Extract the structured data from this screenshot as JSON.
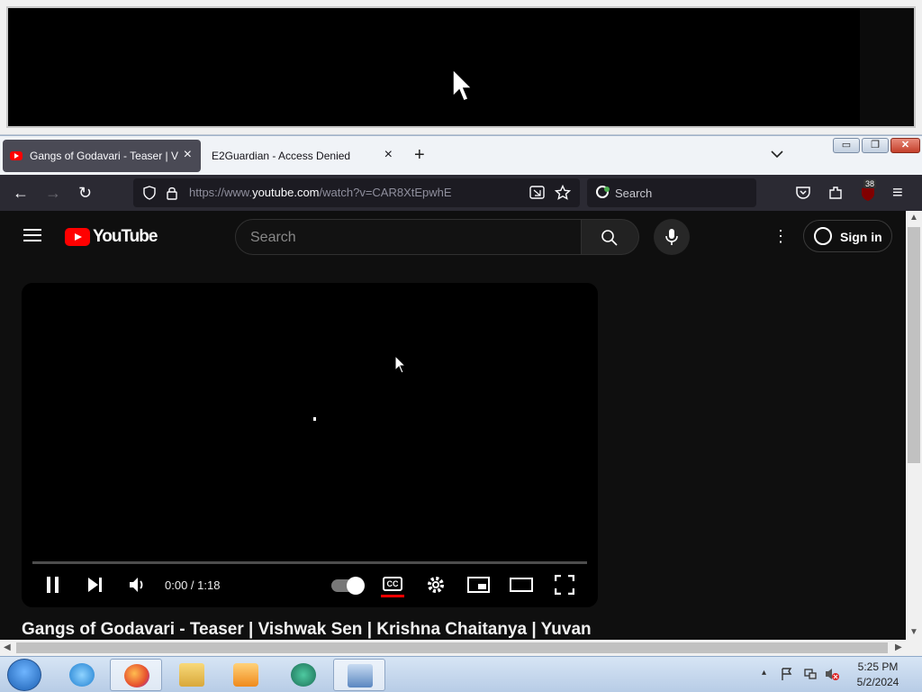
{
  "capture_window": {},
  "browser": {
    "tabs": [
      {
        "title": "Gangs of Godavari - Teaser | Vis",
        "close": "×",
        "active": true
      },
      {
        "title": "E2Guardian - Access Denied",
        "close": "×",
        "active": false
      }
    ],
    "new_tab": "+",
    "tab_list": "⌄",
    "window_buttons": {
      "minimize": "▭",
      "maximize": "❐",
      "close": "✕"
    },
    "nav": {
      "back": "←",
      "forward": "→",
      "reload": "↻"
    },
    "url": {
      "prefix": "https://www.",
      "domain": "youtube.com",
      "path": "/watch?v=CAR8XtEpwhE"
    },
    "search_placeholder": "Search",
    "extension_badge": "38",
    "menu": "≡"
  },
  "youtube": {
    "logo_text": "YouTube",
    "search_placeholder": "Search",
    "more": "⋮",
    "sign_in": "Sign in",
    "player": {
      "time": "0:00 / 1:18",
      "cc_label": "CC",
      "progress": 0
    },
    "video_title": "Gangs of Godavari - Teaser | Vishwak Sen | Krishna Chaitanya | Yuvan"
  },
  "taskbar": {
    "time": "5:25 PM",
    "date": "5/2/2024",
    "tray_up": "▴"
  },
  "colors": {
    "yt_red": "#ff0000",
    "yt_bg": "#0f0f0f",
    "firefox_toolbar": "#2b2a33"
  }
}
